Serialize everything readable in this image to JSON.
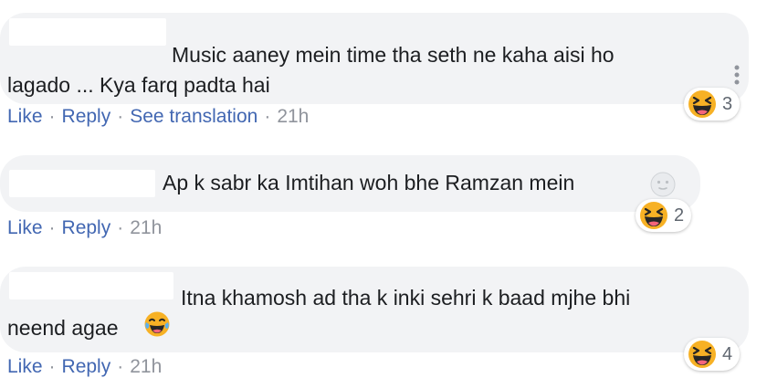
{
  "comments": [
    {
      "text": "Music aaney mein time tha seth ne kaha aisi ho\nlagado ... Kya farq padta hai",
      "like": "Like",
      "reply": "Reply",
      "translate": "See translation",
      "time": "21h",
      "reaction_count": "3",
      "reaction_icon": "laughing-squint-emoji"
    },
    {
      "text": "Ap k sabr ka Imtihan woh bhe Ramzan mein",
      "trailing_emoji": "moon-face-emoji",
      "like": "Like",
      "reply": "Reply",
      "time": "21h",
      "reaction_count": "2",
      "reaction_icon": "laughing-squint-emoji"
    },
    {
      "text": "Itna khamosh ad tha k inki sehri k baad mjhe bhi\nneend agae",
      "trailing_emoji": "tears-of-joy-emoji",
      "like": "Like",
      "reply": "Reply",
      "time": "21h",
      "reaction_count": "4",
      "reaction_icon": "laughing-squint-emoji"
    }
  ],
  "colors": {
    "bubble": "#f2f3f5",
    "link": "#4267b2",
    "meta": "#90949c",
    "text": "#1c1e21",
    "emoji": "#f7b125"
  }
}
